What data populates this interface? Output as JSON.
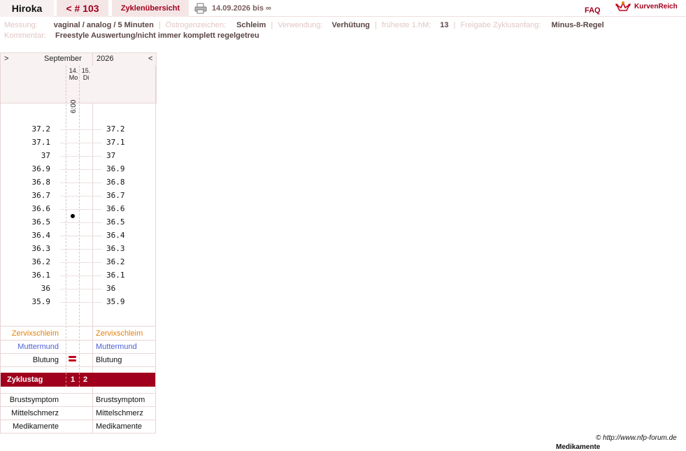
{
  "topbar": {
    "user": "Hiroka",
    "cycle": "< # 103",
    "overview": "Zyklenübersicht",
    "daterange": "14.09.2026 bis ∞",
    "faq": "FAQ",
    "brand": "KurvenReich"
  },
  "info": {
    "messung_label": "Messung:",
    "messung_value": "vaginal / analog / 5 Minuten",
    "oestrogen_label": "Östrogenzeichen:",
    "oestrogen_value": "Schleim",
    "verwendung_label": "Verwendung:",
    "verwendung_value": "Verhütung",
    "hm_label": "früheste 1.hM:",
    "hm_value": "13",
    "freigabe_label": "Freigabe Zyklusanfang:",
    "freigabe_value": "Minus-8-Regel",
    "kommentar_label": "Kommentar:",
    "kommentar_value": "Freestyle Auswertung/nicht immer komplett regelgetreu"
  },
  "chart": {
    "nav_next": ">",
    "month": "September",
    "year": "2026",
    "nav_prev": "<",
    "days": [
      {
        "day": "14.",
        "weekday": "Mo",
        "time": "6:00",
        "temp": 36.55,
        "zyklustag": "1",
        "blutung": true
      },
      {
        "day": "15.",
        "weekday": "Di",
        "time": "",
        "temp": null,
        "zyklustag": "2",
        "blutung": false
      }
    ],
    "temps": [
      "37.2",
      "37.1",
      "37",
      "36.9",
      "36.8",
      "36.7",
      "36.6",
      "36.5",
      "36.4",
      "36.3",
      "36.2",
      "36.1",
      "36",
      "35.9"
    ],
    "rows": {
      "zervix": "Zervixschleim",
      "muttermund": "Muttermund",
      "blutung": "Blutung",
      "zyklustag": "Zyklustag",
      "brust": "Brustsymptom",
      "mittel": "Mittelschmerz",
      "medi": "Medikamente"
    },
    "colors": {
      "accent": "#a0001d",
      "zervix": "#e4810a",
      "muttermund": "#4d5fd6"
    }
  },
  "footer": {
    "copyright": "© http://www.nfp-forum.de",
    "cut_text": "Medikamente"
  }
}
